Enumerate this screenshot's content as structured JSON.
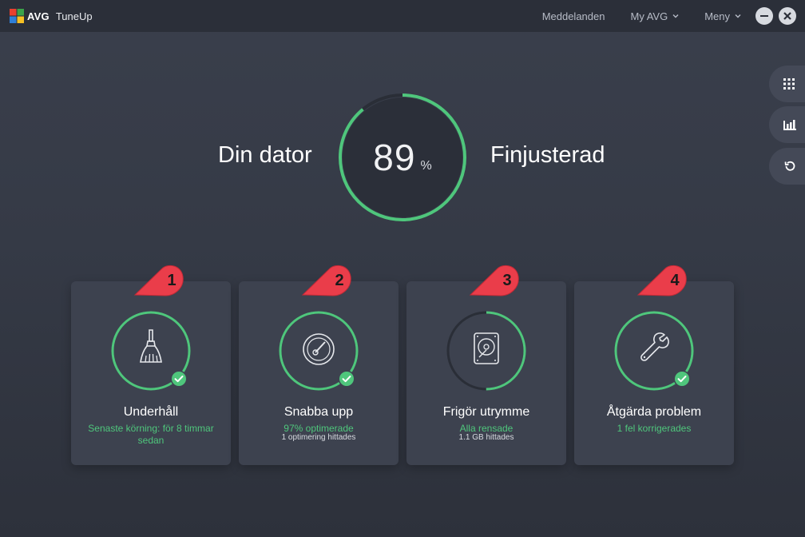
{
  "titlebar": {
    "brand": "AVG",
    "product": "TuneUp",
    "nav": [
      "Meddelanden",
      "My AVG",
      "Meny"
    ]
  },
  "icons": {
    "minimize": "minimize-icon",
    "close": "close-icon",
    "side": [
      "apps-grid-icon",
      "bar-chart-icon",
      "undo-icon"
    ]
  },
  "hero": {
    "left_text": "Din dator",
    "score": "89",
    "unit": "%",
    "right_text": "Finjusterad",
    "score_fraction": 0.89
  },
  "cards": [
    {
      "badge": "1",
      "title": "Underhåll",
      "status": "Senaste körning: för 8 timmar sedan",
      "detail": "",
      "icon": "broom-icon",
      "ring_fraction": 1.0,
      "checked": true
    },
    {
      "badge": "2",
      "title": "Snabba upp",
      "status": "97% optimerade",
      "detail": "1 optimering hittades",
      "icon": "speedometer-icon",
      "ring_fraction": 1.0,
      "checked": true
    },
    {
      "badge": "3",
      "title": "Frigör utrymme",
      "status": "Alla rensade",
      "detail": "1.1 GB hittades",
      "icon": "hard-drive-icon",
      "ring_fraction": 0.5,
      "checked": false
    },
    {
      "badge": "4",
      "title": "Åtgärda problem",
      "status": "1 fel korrigerades",
      "detail": "",
      "icon": "wrench-icon",
      "ring_fraction": 1.0,
      "checked": true
    }
  ],
  "colors": {
    "accent_green": "#4fc67c",
    "badge_red": "#ea3d4a",
    "card_bg": "#3d424f"
  }
}
